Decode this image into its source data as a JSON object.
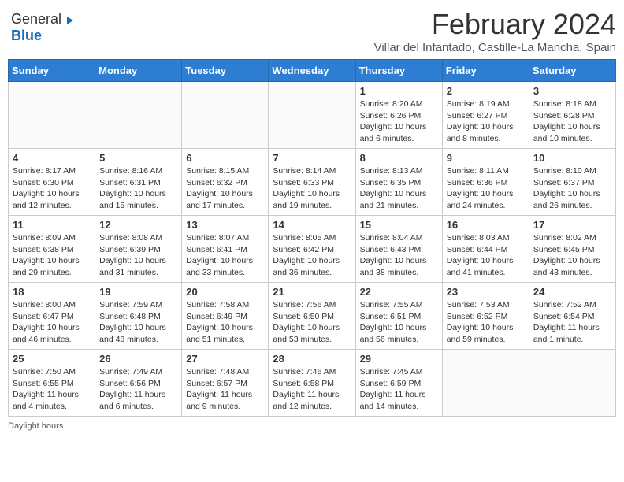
{
  "logo": {
    "general": "General",
    "blue": "Blue"
  },
  "title": "February 2024",
  "subtitle": "Villar del Infantado, Castille-La Mancha, Spain",
  "days_of_week": [
    "Sunday",
    "Monday",
    "Tuesday",
    "Wednesday",
    "Thursday",
    "Friday",
    "Saturday"
  ],
  "weeks": [
    [
      {
        "day": "",
        "info": ""
      },
      {
        "day": "",
        "info": ""
      },
      {
        "day": "",
        "info": ""
      },
      {
        "day": "",
        "info": ""
      },
      {
        "day": "1",
        "info": "Sunrise: 8:20 AM\nSunset: 6:26 PM\nDaylight: 10 hours\nand 6 minutes."
      },
      {
        "day": "2",
        "info": "Sunrise: 8:19 AM\nSunset: 6:27 PM\nDaylight: 10 hours\nand 8 minutes."
      },
      {
        "day": "3",
        "info": "Sunrise: 8:18 AM\nSunset: 6:28 PM\nDaylight: 10 hours\nand 10 minutes."
      }
    ],
    [
      {
        "day": "4",
        "info": "Sunrise: 8:17 AM\nSunset: 6:30 PM\nDaylight: 10 hours\nand 12 minutes."
      },
      {
        "day": "5",
        "info": "Sunrise: 8:16 AM\nSunset: 6:31 PM\nDaylight: 10 hours\nand 15 minutes."
      },
      {
        "day": "6",
        "info": "Sunrise: 8:15 AM\nSunset: 6:32 PM\nDaylight: 10 hours\nand 17 minutes."
      },
      {
        "day": "7",
        "info": "Sunrise: 8:14 AM\nSunset: 6:33 PM\nDaylight: 10 hours\nand 19 minutes."
      },
      {
        "day": "8",
        "info": "Sunrise: 8:13 AM\nSunset: 6:35 PM\nDaylight: 10 hours\nand 21 minutes."
      },
      {
        "day": "9",
        "info": "Sunrise: 8:11 AM\nSunset: 6:36 PM\nDaylight: 10 hours\nand 24 minutes."
      },
      {
        "day": "10",
        "info": "Sunrise: 8:10 AM\nSunset: 6:37 PM\nDaylight: 10 hours\nand 26 minutes."
      }
    ],
    [
      {
        "day": "11",
        "info": "Sunrise: 8:09 AM\nSunset: 6:38 PM\nDaylight: 10 hours\nand 29 minutes."
      },
      {
        "day": "12",
        "info": "Sunrise: 8:08 AM\nSunset: 6:39 PM\nDaylight: 10 hours\nand 31 minutes."
      },
      {
        "day": "13",
        "info": "Sunrise: 8:07 AM\nSunset: 6:41 PM\nDaylight: 10 hours\nand 33 minutes."
      },
      {
        "day": "14",
        "info": "Sunrise: 8:05 AM\nSunset: 6:42 PM\nDaylight: 10 hours\nand 36 minutes."
      },
      {
        "day": "15",
        "info": "Sunrise: 8:04 AM\nSunset: 6:43 PM\nDaylight: 10 hours\nand 38 minutes."
      },
      {
        "day": "16",
        "info": "Sunrise: 8:03 AM\nSunset: 6:44 PM\nDaylight: 10 hours\nand 41 minutes."
      },
      {
        "day": "17",
        "info": "Sunrise: 8:02 AM\nSunset: 6:45 PM\nDaylight: 10 hours\nand 43 minutes."
      }
    ],
    [
      {
        "day": "18",
        "info": "Sunrise: 8:00 AM\nSunset: 6:47 PM\nDaylight: 10 hours\nand 46 minutes."
      },
      {
        "day": "19",
        "info": "Sunrise: 7:59 AM\nSunset: 6:48 PM\nDaylight: 10 hours\nand 48 minutes."
      },
      {
        "day": "20",
        "info": "Sunrise: 7:58 AM\nSunset: 6:49 PM\nDaylight: 10 hours\nand 51 minutes."
      },
      {
        "day": "21",
        "info": "Sunrise: 7:56 AM\nSunset: 6:50 PM\nDaylight: 10 hours\nand 53 minutes."
      },
      {
        "day": "22",
        "info": "Sunrise: 7:55 AM\nSunset: 6:51 PM\nDaylight: 10 hours\nand 56 minutes."
      },
      {
        "day": "23",
        "info": "Sunrise: 7:53 AM\nSunset: 6:52 PM\nDaylight: 10 hours\nand 59 minutes."
      },
      {
        "day": "24",
        "info": "Sunrise: 7:52 AM\nSunset: 6:54 PM\nDaylight: 11 hours\nand 1 minute."
      }
    ],
    [
      {
        "day": "25",
        "info": "Sunrise: 7:50 AM\nSunset: 6:55 PM\nDaylight: 11 hours\nand 4 minutes."
      },
      {
        "day": "26",
        "info": "Sunrise: 7:49 AM\nSunset: 6:56 PM\nDaylight: 11 hours\nand 6 minutes."
      },
      {
        "day": "27",
        "info": "Sunrise: 7:48 AM\nSunset: 6:57 PM\nDaylight: 11 hours\nand 9 minutes."
      },
      {
        "day": "28",
        "info": "Sunrise: 7:46 AM\nSunset: 6:58 PM\nDaylight: 11 hours\nand 12 minutes."
      },
      {
        "day": "29",
        "info": "Sunrise: 7:45 AM\nSunset: 6:59 PM\nDaylight: 11 hours\nand 14 minutes."
      },
      {
        "day": "",
        "info": ""
      },
      {
        "day": "",
        "info": ""
      }
    ]
  ],
  "footer": {
    "daylight_label": "Daylight hours"
  }
}
